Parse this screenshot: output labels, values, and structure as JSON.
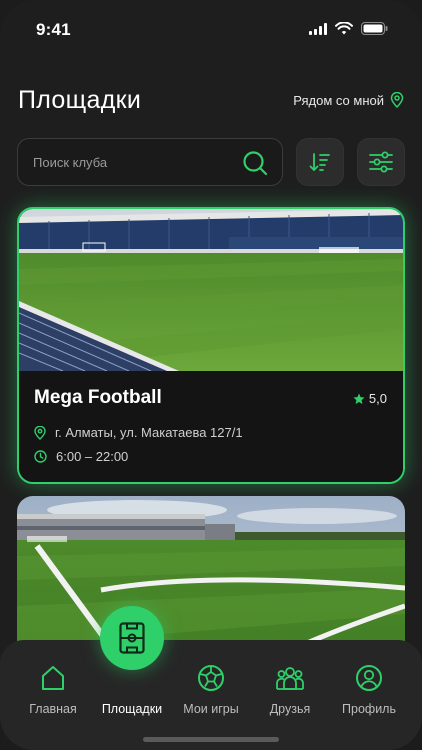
{
  "status_bar": {
    "time": "9:41"
  },
  "header": {
    "title": "Площадки",
    "nearby_label": "Рядом со мной"
  },
  "search": {
    "placeholder": "Поиск клуба"
  },
  "cards": [
    {
      "name": "Mega Football",
      "rating": "5,0",
      "address": "г. Алматы, ул. Макатаева 127/1",
      "hours": "6:00 – 22:00"
    }
  ],
  "nav": {
    "items": [
      {
        "label": "Главная",
        "icon": "home-icon"
      },
      {
        "label": "Площадки",
        "icon": "field-icon"
      },
      {
        "label": "Мои игры",
        "icon": "ball-icon"
      },
      {
        "label": "Друзья",
        "icon": "friends-icon"
      },
      {
        "label": "Профиль",
        "icon": "profile-icon"
      }
    ]
  },
  "colors": {
    "accent": "#2fcf6a",
    "background": "#1e1e1e",
    "card": "#141414"
  }
}
